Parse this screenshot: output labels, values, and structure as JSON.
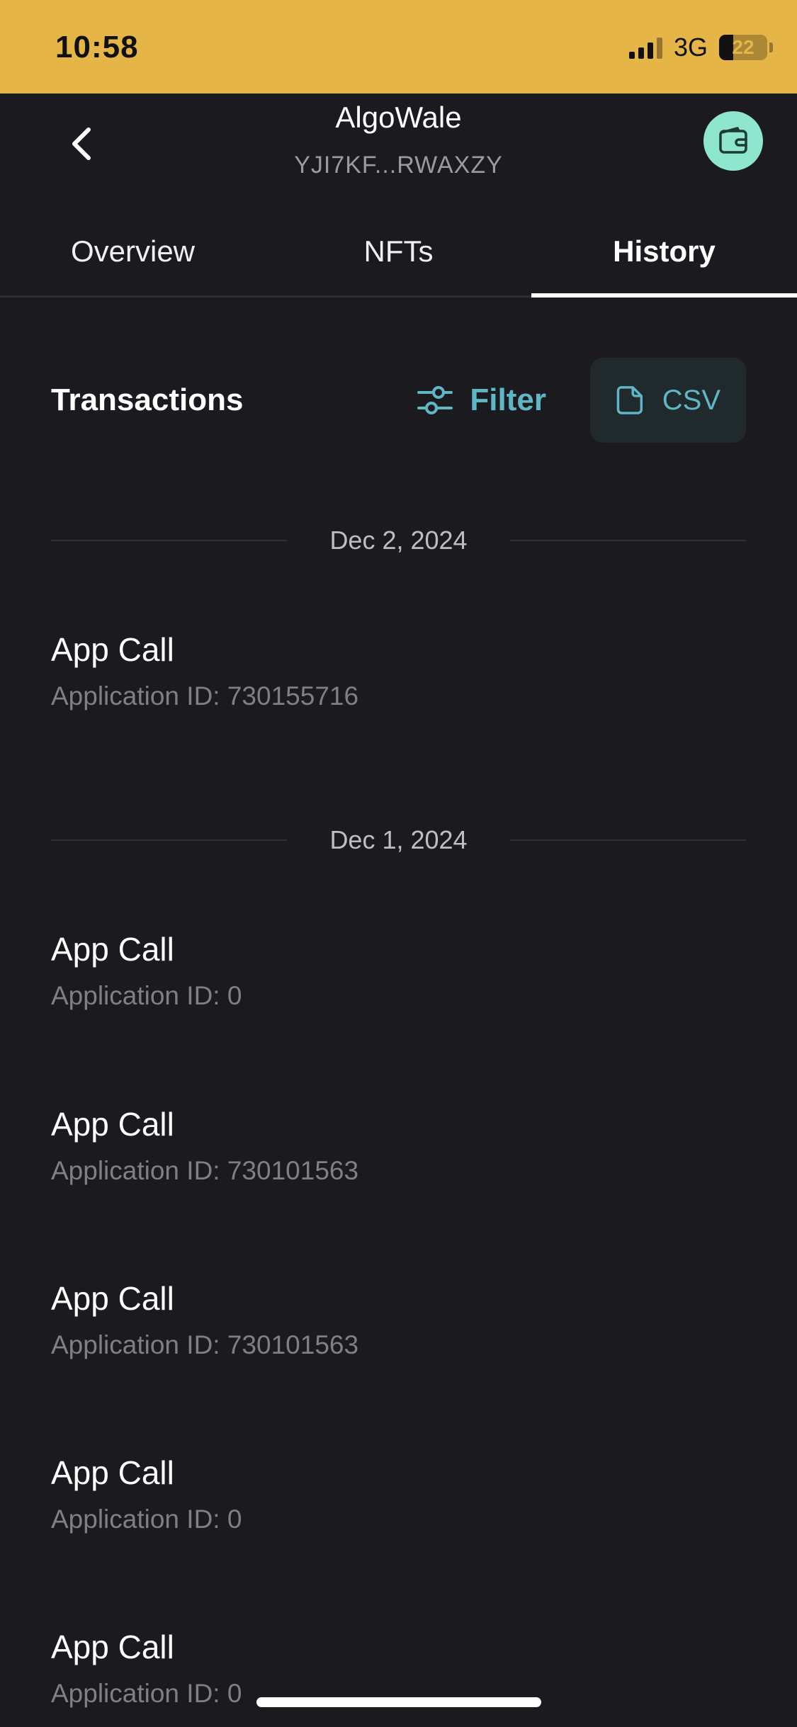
{
  "status_bar": {
    "time": "10:58",
    "network": "3G",
    "battery": "22"
  },
  "header": {
    "title": "AlgoWale",
    "address": "YJI7KF...RWAXZY"
  },
  "tabs": [
    {
      "label": "Overview",
      "active": false
    },
    {
      "label": "NFTs",
      "active": false
    },
    {
      "label": "History",
      "active": true
    }
  ],
  "transactions": {
    "title": "Transactions",
    "filter_label": "Filter",
    "csv_label": "CSV"
  },
  "groups": [
    {
      "date": "Dec 2, 2024",
      "items": [
        {
          "name": "App Call",
          "detail": "Application ID: 730155716"
        }
      ]
    },
    {
      "date": "Dec 1, 2024",
      "items": [
        {
          "name": "App Call",
          "detail": "Application ID: 0"
        },
        {
          "name": "App Call",
          "detail": "Application ID: 730101563"
        },
        {
          "name": "App Call",
          "detail": "Application ID: 730101563"
        },
        {
          "name": "App Call",
          "detail": "Application ID: 0"
        },
        {
          "name": "App Call",
          "detail": "Application ID: 0"
        }
      ]
    }
  ],
  "colors": {
    "status_bar": "#e5b548",
    "background": "#1a1a1f",
    "accent": "#5fb6c4",
    "wallet_button": "#8ee6cf"
  },
  "icons": {
    "back": "chevron-left-icon",
    "wallet": "wallet-icon",
    "filter": "sliders-icon",
    "csv": "file-icon"
  }
}
